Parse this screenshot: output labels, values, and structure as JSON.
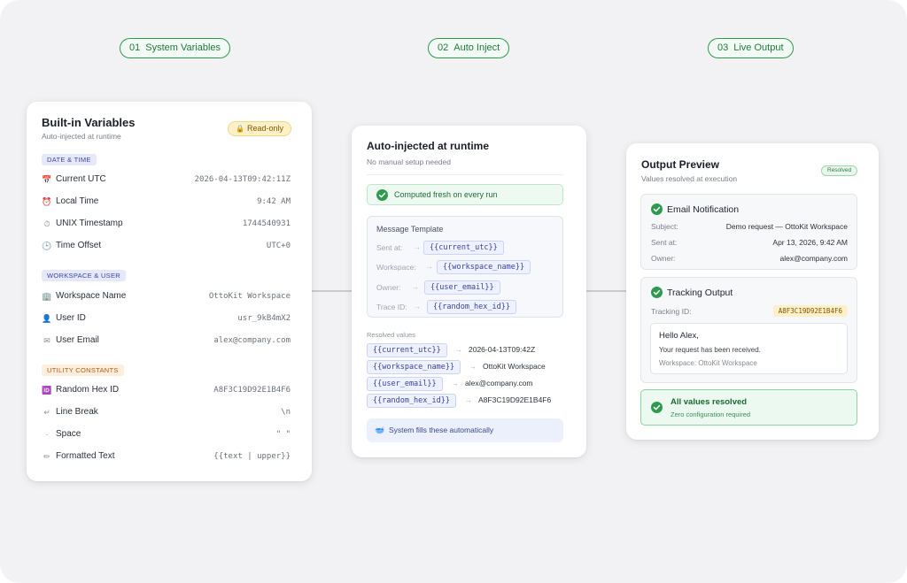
{
  "steps": [
    {
      "num": "01",
      "label": "System Variables"
    },
    {
      "num": "02",
      "label": "Auto Inject"
    },
    {
      "num": "03",
      "label": "Live Output"
    }
  ],
  "builtin": {
    "title": "Built-in Variables",
    "subtitle": "Auto-injected at runtime",
    "badge": "Read-only",
    "badge_icon": "lock-icon",
    "sections": [
      {
        "label": "DATE & TIME",
        "color": "#3d46a8",
        "items": [
          {
            "icon": "calendar-icon",
            "glyph": "📅",
            "name": "Current UTC",
            "value": "2026-04-13T09:42:11Z"
          },
          {
            "icon": "alarm-clock-icon",
            "glyph": "⏰",
            "name": "Local Time",
            "value": "9:42 AM"
          },
          {
            "icon": "stopwatch-icon",
            "glyph": "⏱",
            "name": "UNIX Timestamp",
            "value": "1744540931"
          },
          {
            "icon": "clock-icon",
            "glyph": "🕒",
            "name": "Time Offset",
            "value": "UTC+0"
          }
        ]
      },
      {
        "label": "WORKSPACE & USER",
        "color": "#3d46a8",
        "items": [
          {
            "icon": "building-icon",
            "glyph": "🏢",
            "name": "Workspace Name",
            "value": "OttoKit Workspace"
          },
          {
            "icon": "user-icon",
            "glyph": "👤",
            "name": "User ID",
            "value": "usr_9kB4mX2"
          },
          {
            "icon": "envelope-icon",
            "glyph": "✉",
            "name": "User Email",
            "value": "alex@company.com"
          }
        ]
      },
      {
        "label": "UTILITY CONSTANTS",
        "color": "#b45a10",
        "items": [
          {
            "icon": "id-card-icon",
            "glyph": "🆔",
            "name": "Random Hex ID",
            "value": "A8F3C19D92E1B4F6"
          },
          {
            "icon": "return-arrow-icon",
            "glyph": "↵",
            "name": "Line Break",
            "value": "\\n"
          },
          {
            "icon": "dot-icon",
            "glyph": "·",
            "name": "Space",
            "value": "\" \""
          },
          {
            "icon": "pencil-icon",
            "glyph": "✏",
            "name": "Formatted Text",
            "value": "{{text | upper}}"
          }
        ]
      }
    ]
  },
  "inject": {
    "title": "Auto-injected at runtime",
    "subtitle": "No manual setup needed",
    "banner": "Computed fresh on every run",
    "template_title": "Message Template",
    "template_rows": [
      {
        "label": "Sent at:",
        "token": "{{current_utc}}"
      },
      {
        "label": "Workspace:",
        "token": "{{workspace_name}}"
      },
      {
        "label": "Owner:",
        "token": "{{user_email}}"
      },
      {
        "label": "Trace ID:",
        "token": "{{random_hex_id}}"
      }
    ],
    "resolved_title": "Resolved values",
    "resolved_rows": [
      {
        "token": "{{current_utc}}",
        "value": "2026-04-13T09:42Z"
      },
      {
        "token": "{{workspace_name}}",
        "value": "OttoKit Workspace"
      },
      {
        "token": "{{user_email}}",
        "value": "alex@company.com"
      },
      {
        "token": "{{random_hex_id}}",
        "value": "A8F3C19D92E1B4F6"
      }
    ],
    "footer": "System fills these automatically",
    "footer_icon": "bowl-icon"
  },
  "output": {
    "title": "Output Preview",
    "subtitle": "Values resolved at execution",
    "badge": "Resolved",
    "email": {
      "title": "Email Notification",
      "rows": [
        {
          "key": "Subject:",
          "value": "Demo request — OttoKit Workspace"
        },
        {
          "key": "Sent at:",
          "value": "Apr 13, 2026, 9:42 AM"
        },
        {
          "key": "Owner:",
          "value": "alex@company.com"
        }
      ]
    },
    "tracking": {
      "title": "Tracking Output",
      "id_label": "Tracking ID:",
      "id_value": "A8F3C19D92E1B4F6",
      "message": {
        "greeting": "Hello Alex,",
        "body": "Your request has been received.",
        "footer": "Workspace: OttoKit Workspace"
      }
    },
    "resolved": {
      "title": "All values resolved",
      "subtitle": "Zero configuration required"
    }
  },
  "colors": {
    "accent_green": "#2e9a4e",
    "token_blue": "#3a44a0",
    "highlight_yellow": "#fff0c9"
  }
}
